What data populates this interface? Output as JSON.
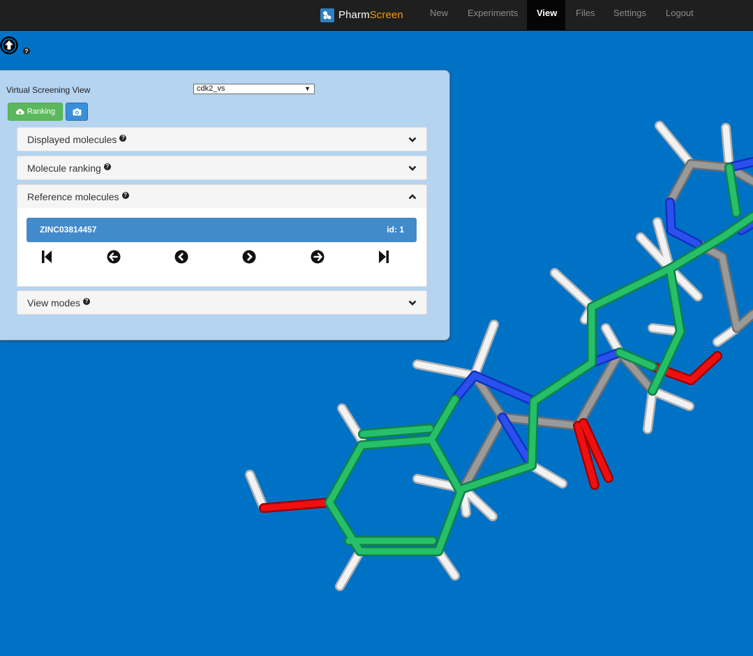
{
  "navbar": {
    "brand_first": "Pharm",
    "brand_second": "Screen",
    "items": [
      {
        "label": "New",
        "active": false
      },
      {
        "label": "Experiments",
        "active": false
      },
      {
        "label": "View",
        "active": true
      },
      {
        "label": "Files",
        "active": false
      },
      {
        "label": "Settings",
        "active": false
      },
      {
        "label": "Logout",
        "active": false
      }
    ]
  },
  "toolbar": {
    "upload_icon": "arrow-circle-up-icon",
    "help_icon": "question-circle-icon"
  },
  "panel": {
    "title": "Virtual Screening View",
    "select_value": "cdk2_vs",
    "ranking_button": "Ranking",
    "camera_icon": "camera-icon"
  },
  "accordion": [
    {
      "label": "Displayed molecules",
      "expanded": false
    },
    {
      "label": "Molecule ranking",
      "expanded": false
    },
    {
      "label": "Reference molecules",
      "expanded": true
    },
    {
      "label": "View modes",
      "expanded": false
    }
  ],
  "reference": {
    "name": "ZINC03814457",
    "id_text": "id: 1",
    "nav_icons": [
      "step-first-icon",
      "arrow-left-circle-icon",
      "chevron-left-circle-icon",
      "chevron-right-circle-icon",
      "arrow-right-circle-icon",
      "step-last-icon"
    ]
  },
  "colors": {
    "background": "#0072c6",
    "navbar": "#1f1f1f",
    "panel": "#b4d4f0",
    "reference_bar": "#428bca",
    "ranking_button": "#5cb85c",
    "carbon_green": "#1fae5a",
    "carbon_gray": "#8c8c8c",
    "nitrogen": "#1a3ee0",
    "oxygen": "#e01010",
    "hydrogen": "#e8e8e8"
  }
}
